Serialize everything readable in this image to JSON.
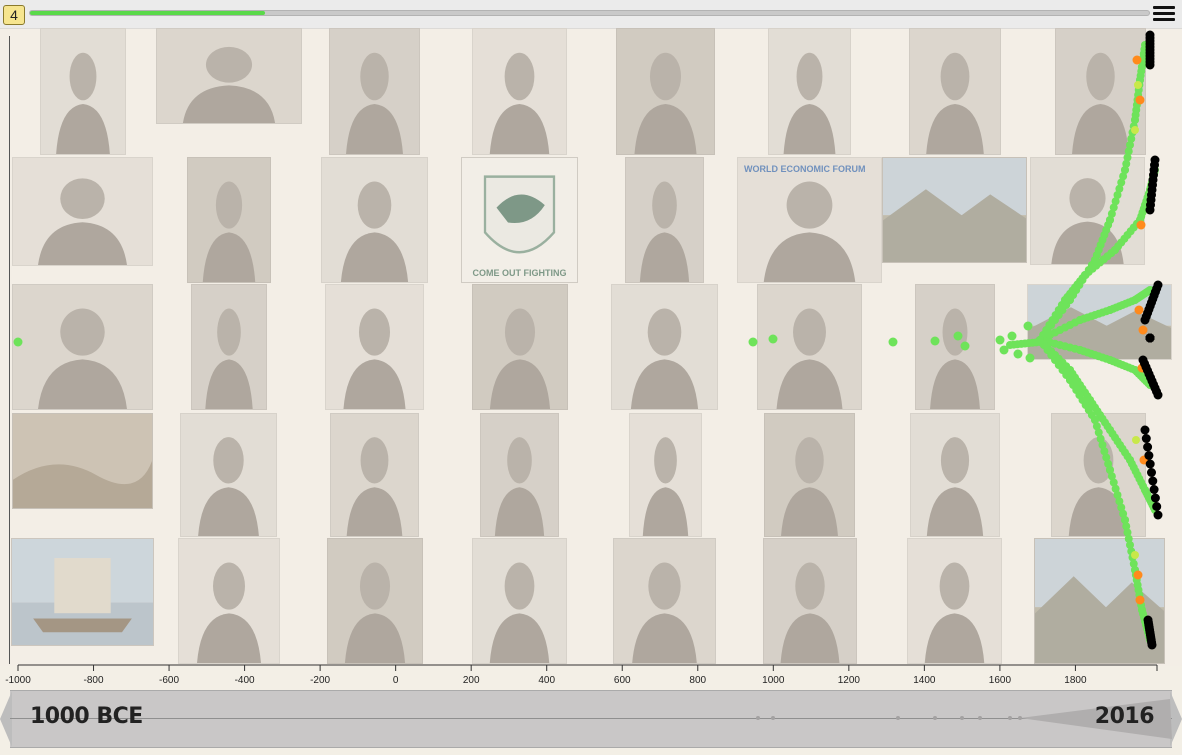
{
  "toolbar": {
    "badge": "4",
    "progress": 0.21,
    "menu_icon": "hamburger-menu-icon"
  },
  "mosaic": {
    "tiles": [
      {
        "subject": "portrait"
      },
      {
        "subject": "portrait"
      },
      {
        "subject": "portrait"
      },
      {
        "subject": "portrait"
      },
      {
        "subject": "portrait"
      },
      {
        "subject": "portrait"
      },
      {
        "subject": "portrait"
      },
      {
        "subject": "portrait"
      },
      {
        "subject": "portrait"
      },
      {
        "subject": "portrait"
      },
      {
        "subject": "portrait"
      },
      {
        "subject": "emblem",
        "caption": "COME OUT FIGHTING"
      },
      {
        "subject": "portrait"
      },
      {
        "subject": "portrait",
        "caption": "WORLD ECONOMIC FORUM"
      },
      {
        "subject": "landscape"
      },
      {
        "subject": "portrait"
      },
      {
        "subject": "portrait"
      },
      {
        "subject": "portrait"
      },
      {
        "subject": "portrait"
      },
      {
        "subject": "portrait"
      },
      {
        "subject": "portrait"
      },
      {
        "subject": "portrait"
      },
      {
        "subject": "portrait"
      },
      {
        "subject": "landscape"
      },
      {
        "subject": "painting"
      },
      {
        "subject": "portrait"
      },
      {
        "subject": "portrait"
      },
      {
        "subject": "portrait"
      },
      {
        "subject": "portrait"
      },
      {
        "subject": "portrait"
      },
      {
        "subject": "portrait"
      },
      {
        "subject": "portrait"
      },
      {
        "subject": "ship"
      },
      {
        "subject": "portrait"
      },
      {
        "subject": "portrait"
      },
      {
        "subject": "portrait"
      },
      {
        "subject": "portrait"
      },
      {
        "subject": "portrait"
      },
      {
        "subject": "portrait"
      },
      {
        "subject": "landscape"
      }
    ]
  },
  "timeline": {
    "axis_min": -1000,
    "axis_max": 2016,
    "ticks": [
      "-1000",
      "-800",
      "-600",
      "-400",
      "-200",
      "0",
      "200",
      "400",
      "600",
      "800",
      "1000",
      "1200",
      "1400",
      "1600",
      "1800"
    ],
    "tick_values": [
      -1000,
      -800,
      -600,
      -400,
      -200,
      0,
      200,
      400,
      600,
      800,
      1000,
      1200,
      1400,
      1600,
      1800
    ],
    "colors": {
      "dot": "#6ee35a",
      "hot": "#ff8a1c",
      "warm": "#c8e84a",
      "black": "#000000"
    }
  },
  "navigator": {
    "start_label": "1000 BCE",
    "end_label": "2016"
  }
}
